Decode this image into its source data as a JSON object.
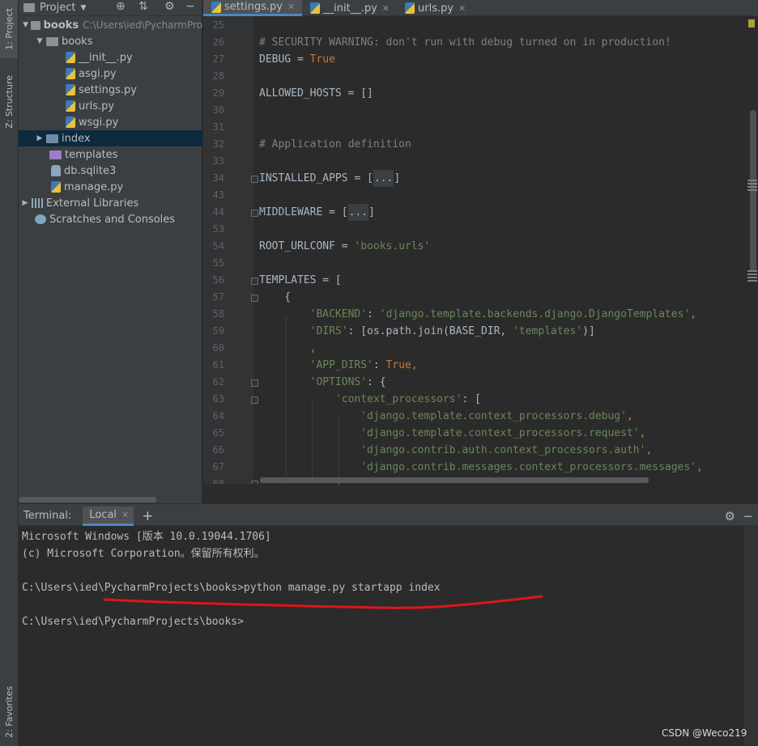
{
  "left_strip": {
    "project_tab": "1: Project",
    "structure_tab": "Z: Structure",
    "favorites_tab": "2: Favorites"
  },
  "project_panel": {
    "title": "Project",
    "tree": [
      {
        "label": "books",
        "path": "C:\\Users\\ied\\PycharmPro",
        "type": "root"
      },
      {
        "label": "books",
        "type": "folder"
      },
      {
        "label": "__init__.py",
        "type": "py"
      },
      {
        "label": "asgi.py",
        "type": "py"
      },
      {
        "label": "settings.py",
        "type": "py"
      },
      {
        "label": "urls.py",
        "type": "py"
      },
      {
        "label": "wsgi.py",
        "type": "py"
      },
      {
        "label": "index",
        "type": "folder",
        "selected": true
      },
      {
        "label": "templates",
        "type": "folder-purple"
      },
      {
        "label": "db.sqlite3",
        "type": "db"
      },
      {
        "label": "manage.py",
        "type": "py"
      },
      {
        "label": "External Libraries",
        "type": "lib"
      },
      {
        "label": "Scratches and Consoles",
        "type": "scratch"
      }
    ]
  },
  "editor_tabs": [
    {
      "label": "settings.py",
      "active": true
    },
    {
      "label": "__init__.py",
      "active": false
    },
    {
      "label": "urls.py",
      "active": false
    }
  ],
  "editor": {
    "line_numbers": [
      "25",
      "26",
      "27",
      "28",
      "29",
      "30",
      "31",
      "32",
      "33",
      "34",
      "43",
      "44",
      "53",
      "54",
      "55",
      "56",
      "57",
      "58",
      "59",
      "60",
      "61",
      "62",
      "63",
      "64",
      "65",
      "66",
      "67",
      "68"
    ],
    "lines": {
      "l26": "# SECURITY WARNING: don't run with debug turned on in production!",
      "l27_a": "DEBUG = ",
      "l27_b": "True",
      "l29": "ALLOWED_HOSTS = []",
      "l32": "# Application definition",
      "l34_a": "INSTALLED_APPS = [",
      "l34_b": "...",
      "l34_c": "]",
      "l44_a": "MIDDLEWARE = [",
      "l44_b": "...",
      "l44_c": "]",
      "l54_a": "ROOT_URLCONF = ",
      "l54_b": "'books.urls'",
      "l56": "TEMPLATES = [",
      "l57": "    {",
      "l58_a": "        'BACKEND'",
      "l58_b": ": ",
      "l58_c": "'django.template.backends.django.DjangoTemplates'",
      "l58_d": ",",
      "l59_a": "        'DIRS'",
      "l59_b": ": [os.path.join(BASE_DIR, ",
      "l59_c": "'templates'",
      "l59_d": ")]",
      "l60": "        ,",
      "l61_a": "        'APP_DIRS'",
      "l61_b": ": ",
      "l61_c": "True",
      "l61_d": ",",
      "l62_a": "        'OPTIONS'",
      "l62_b": ": {",
      "l63_a": "            'context_processors'",
      "l63_b": ": [",
      "l64_a": "                'django.template.context_processors.debug'",
      "l64_b": ",",
      "l65_a": "                'django.template.context_processors.request'",
      "l65_b": ",",
      "l66_a": "                'django.contrib.auth.context_processors.auth'",
      "l66_b": ",",
      "l67_a": "                'django.contrib.messages.context_processors.messages'",
      "l67_b": ",",
      "l68": "            ],"
    }
  },
  "terminal": {
    "label": "Terminal:",
    "tab": "Local",
    "lines": [
      "Microsoft Windows [版本 10.0.19044.1706]",
      "(c) Microsoft Corporation。保留所有权利。",
      "",
      "C:\\Users\\ied\\PycharmProjects\\books>python manage.py startapp index",
      "",
      "C:\\Users\\ied\\PycharmProjects\\books>"
    ]
  },
  "watermark": "CSDN @Weco219",
  "colors": {
    "keyword": "#cc7832",
    "string": "#6a8759",
    "comment": "#808080",
    "selection": "#0d293e",
    "annotation_red": "#e0151b"
  }
}
